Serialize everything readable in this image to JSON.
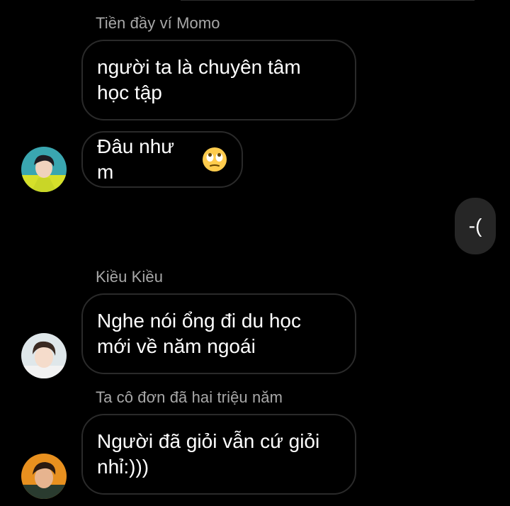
{
  "messages": [
    {
      "sender": "Tiền đầy ví Momo"
    },
    {
      "text": "người ta là chuyên tâm\nhọc tập"
    },
    {
      "text": "Đâu như m",
      "emoji": "face-with-rolling-eyes-icon"
    },
    {
      "outgoing_text": "-("
    },
    {
      "sender": "Kiều Kiều"
    },
    {
      "text": "Nghe nói ổng đi du học\nmới về năm ngoái"
    },
    {
      "sender": "Ta cô đơn đã hai triệu năm"
    },
    {
      "text": "Người đã giỏi vẫn cứ giỏi\nnhỉ:)))"
    }
  ],
  "colors": {
    "background": "#000000",
    "bubble_border": "#2a2a2a",
    "outgoing_bubble": "#262626",
    "sender_name": "#a8a8a8"
  }
}
